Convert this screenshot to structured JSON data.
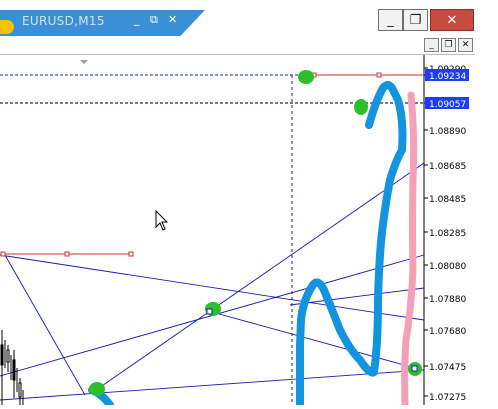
{
  "window": {
    "tab_title": "EURUSD,M15",
    "tab_controls": [
      "_",
      "⧉",
      "✕"
    ],
    "buttons": {
      "minimize": "_",
      "restore": "❐",
      "close": "✕"
    },
    "inner_buttons": {
      "minimize": "_",
      "restore": "❐",
      "close": "✕"
    }
  },
  "chart": {
    "price_labels": [
      {
        "text": "1.09290",
        "highlighted": false
      },
      {
        "text": "1.09234",
        "highlighted": true
      },
      {
        "text": "1.09057",
        "highlighted": true
      },
      {
        "text": "1.08890",
        "highlighted": false
      },
      {
        "text": "1.08685",
        "highlighted": false
      },
      {
        "text": "1.08485",
        "highlighted": false
      },
      {
        "text": "1.08285",
        "highlighted": false
      },
      {
        "text": "1.08080",
        "highlighted": false
      },
      {
        "text": "1.07880",
        "highlighted": false
      },
      {
        "text": "1.07680",
        "highlighted": false
      },
      {
        "text": "1.07475",
        "highlighted": false
      },
      {
        "text": "1.07275",
        "highlighted": false
      }
    ],
    "colors": {
      "axis_highlight_bg": "#1d3cff",
      "trendline": "#1a1ab0",
      "red_line": "#cc3333",
      "dashed_line": "#1b2a6b",
      "blue_marker": "#1295de",
      "pink_marker": "#f4a0b8",
      "green_dot": "#2bbf2b"
    }
  }
}
